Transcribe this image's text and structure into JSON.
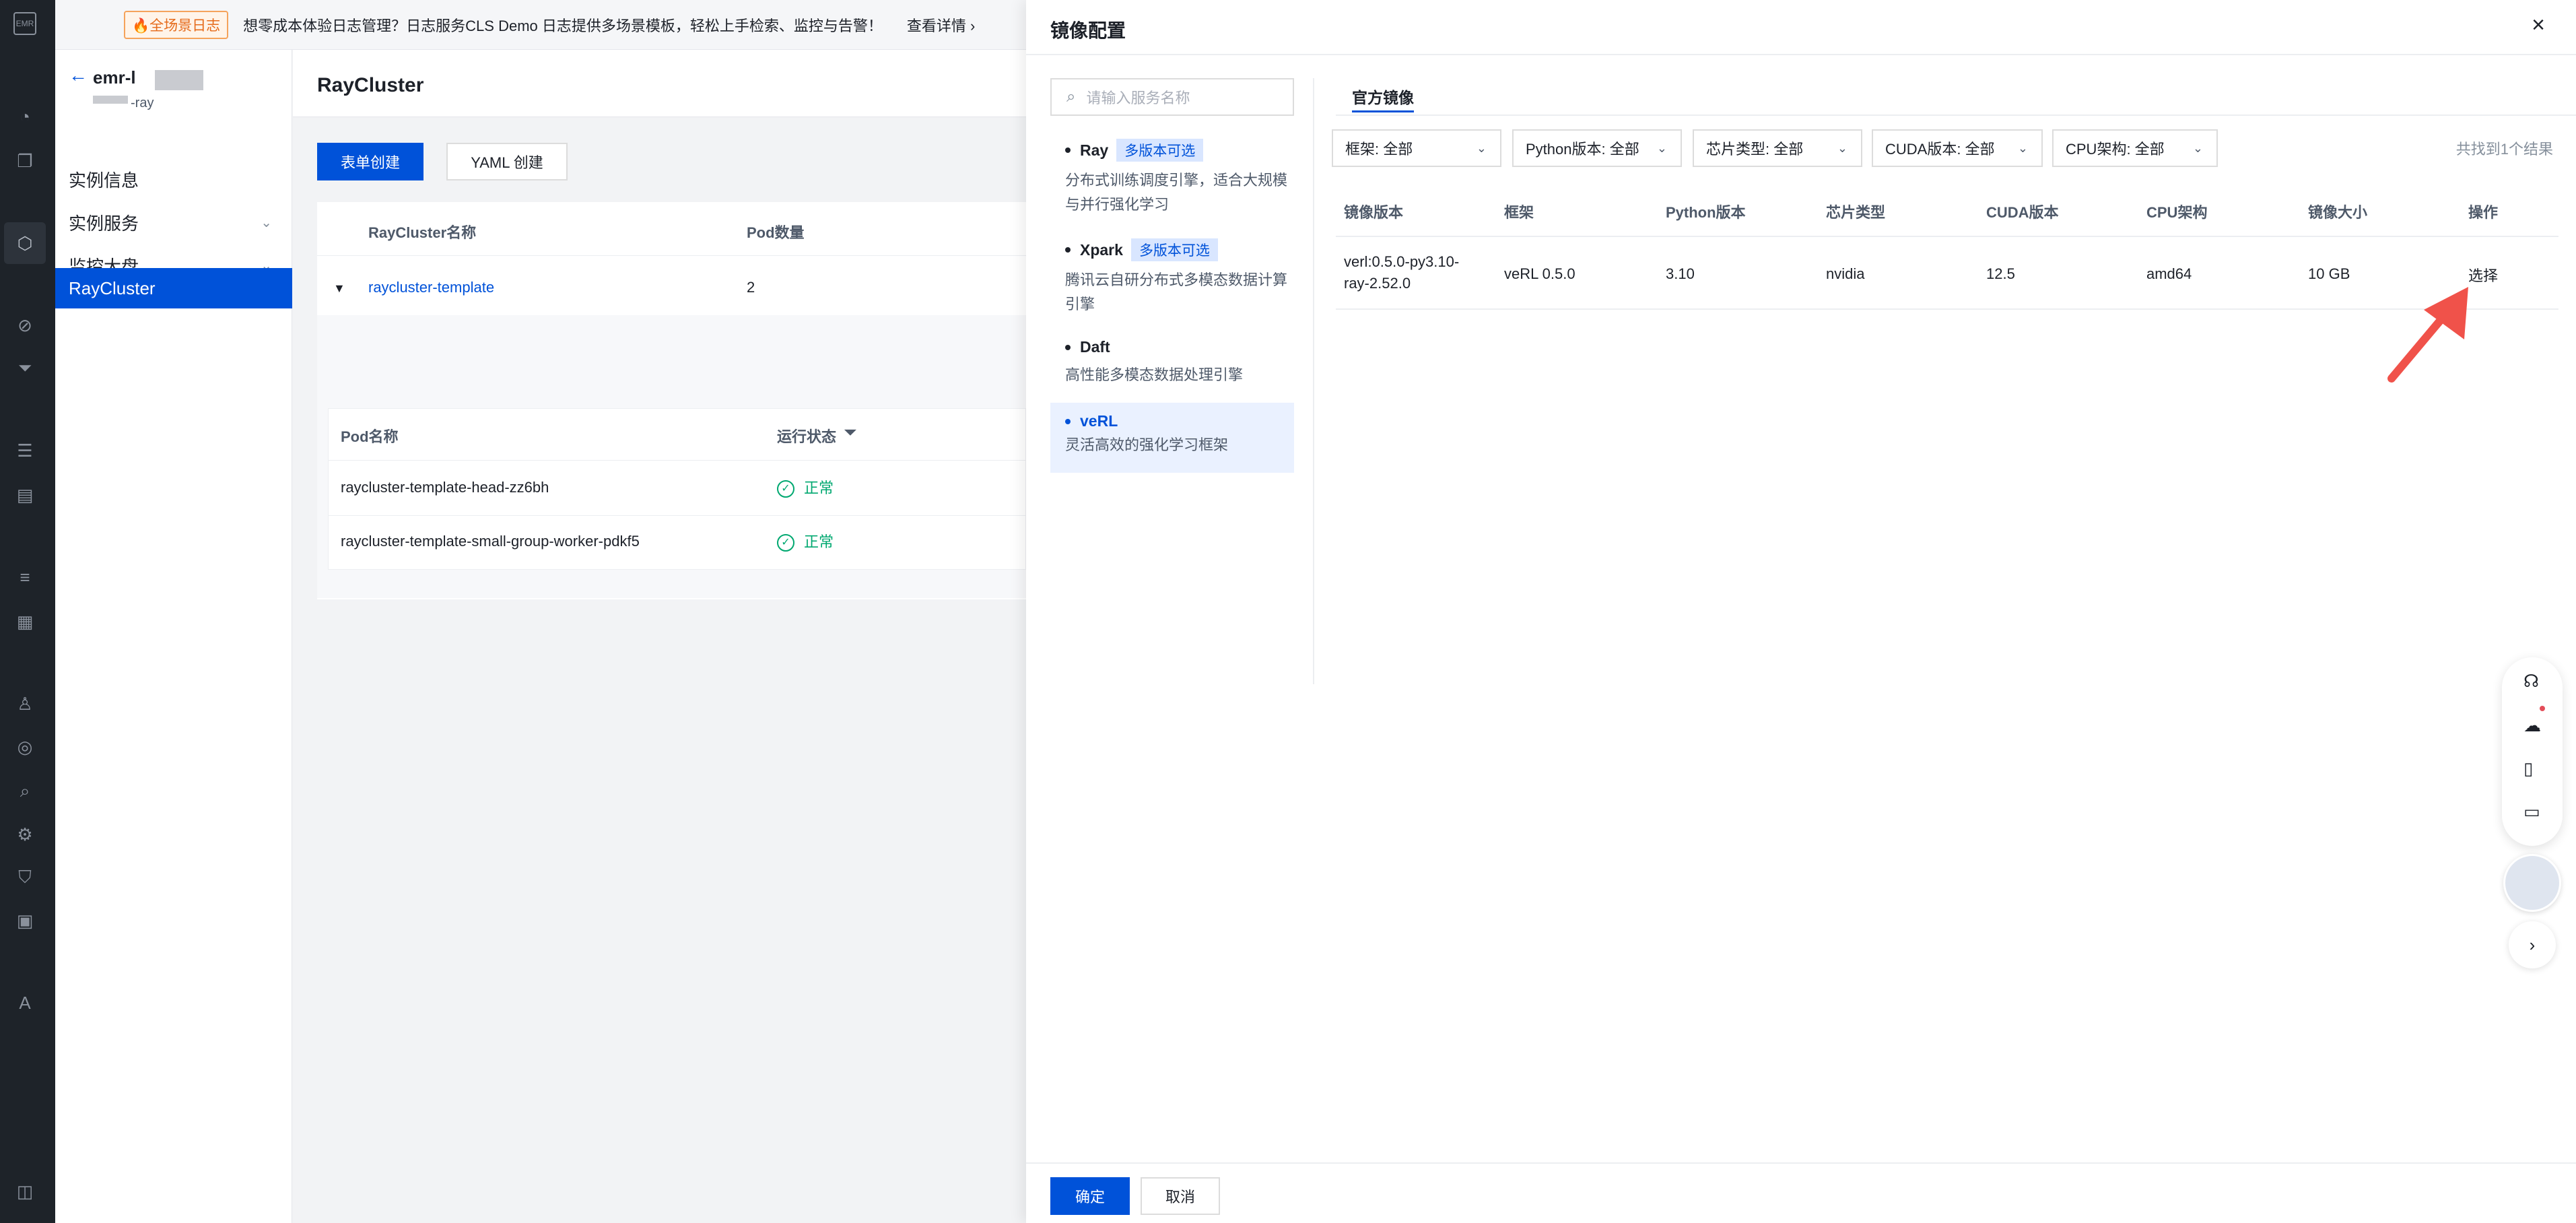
{
  "banner": {
    "tag": "🔥全场景日志",
    "text": "想零成本体验日志管理？日志服务CLS Demo 日志提供多场景模板，轻松上手检索、监控与告警！",
    "link": "查看详情 ›"
  },
  "nav": {
    "title": "emr-l",
    "subtitle": "-ray",
    "items": [
      {
        "label": "实例信息"
      },
      {
        "label": "实例服务"
      },
      {
        "label": "监控大盘"
      },
      {
        "label": "RayCluster"
      }
    ]
  },
  "page": {
    "title": "RayCluster",
    "btn_form": "表单创建",
    "btn_yaml": "YAML 创建",
    "table": {
      "col_name": "RayCluster名称",
      "col_pods": "Pod数量",
      "row_name": "raycluster-template",
      "row_pods": "2"
    },
    "pods": {
      "col_name": "Pod名称",
      "col_status": "运行状态",
      "rows": [
        {
          "name": "raycluster-template-head-zz6bh",
          "status": "正常"
        },
        {
          "name": "raycluster-template-small-group-worker-pdkf5",
          "status": "正常"
        }
      ]
    }
  },
  "drawer": {
    "title": "镜像配置",
    "search_placeholder": "请输入服务名称",
    "services": [
      {
        "name": "Ray",
        "badge": "多版本可选",
        "desc": "分布式训练调度引擎，适合大规模与并行强化学习"
      },
      {
        "name": "Xpark",
        "badge": "多版本可选",
        "desc": "腾讯云自研分布式多模态数据计算引擎"
      },
      {
        "name": "Daft",
        "badge": "",
        "desc": "高性能多模态数据处理引擎"
      },
      {
        "name": "veRL",
        "badge": "",
        "desc": "灵活高效的强化学习框架"
      }
    ],
    "tab": "官方镜像",
    "filters": [
      "框架: 全部",
      "Python版本: 全部",
      "芯片类型: 全部",
      "CUDA版本: 全部",
      "CPU架构: 全部"
    ],
    "result_count": "共找到1个结果",
    "columns": [
      "镜像版本",
      "框架",
      "Python版本",
      "芯片类型",
      "CUDA版本",
      "CPU架构",
      "镜像大小",
      "操作"
    ],
    "row": {
      "version_line1": "verl:0.5.0-py3.10-",
      "version_line2": "ray-2.52.0",
      "framework": "veRL 0.5.0",
      "python": "3.10",
      "chip": "nvidia",
      "cuda": "12.5",
      "cpu": "amd64",
      "size": "10 GB",
      "action": "选择"
    },
    "ok": "确定",
    "cancel": "取消"
  },
  "colors": {
    "primary": "#0052d9",
    "success": "#00a870",
    "annotation_arrow": "#f0524a"
  }
}
